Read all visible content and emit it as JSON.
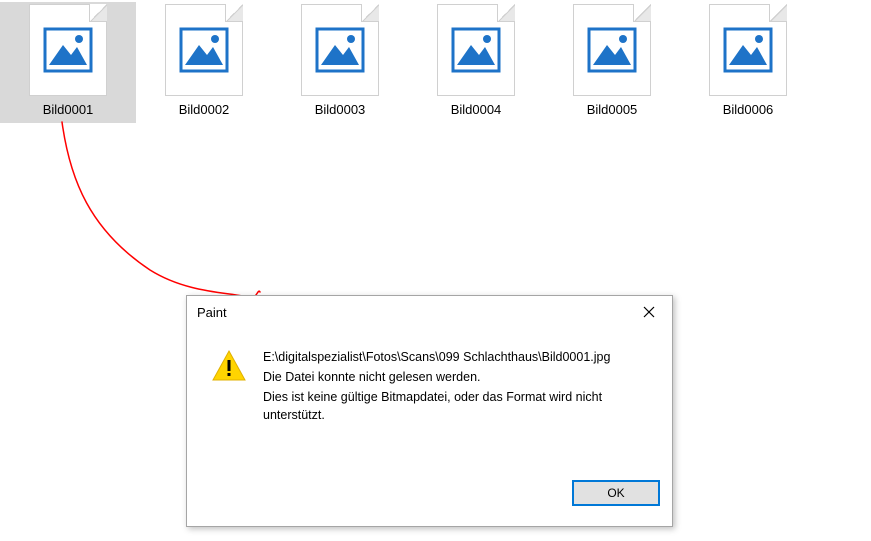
{
  "files": [
    {
      "name": "Bild0001",
      "selected": true
    },
    {
      "name": "Bild0002",
      "selected": false
    },
    {
      "name": "Bild0003",
      "selected": false
    },
    {
      "name": "Bild0004",
      "selected": false
    },
    {
      "name": "Bild0005",
      "selected": false
    },
    {
      "name": "Bild0006",
      "selected": false
    }
  ],
  "annotation": {
    "stroke": "#ff0000"
  },
  "dialog": {
    "title": "Paint",
    "ok_label": "OK",
    "message": {
      "path": "E:\\digitalspezialist\\Fotos\\Scans\\099 Schlachthaus\\Bild0001.jpg",
      "line2": "Die Datei konnte nicht gelesen werden.",
      "line3": "Dies ist keine gültige Bitmapdatei, oder das Format wird nicht unterstützt."
    },
    "icon": "warning"
  }
}
